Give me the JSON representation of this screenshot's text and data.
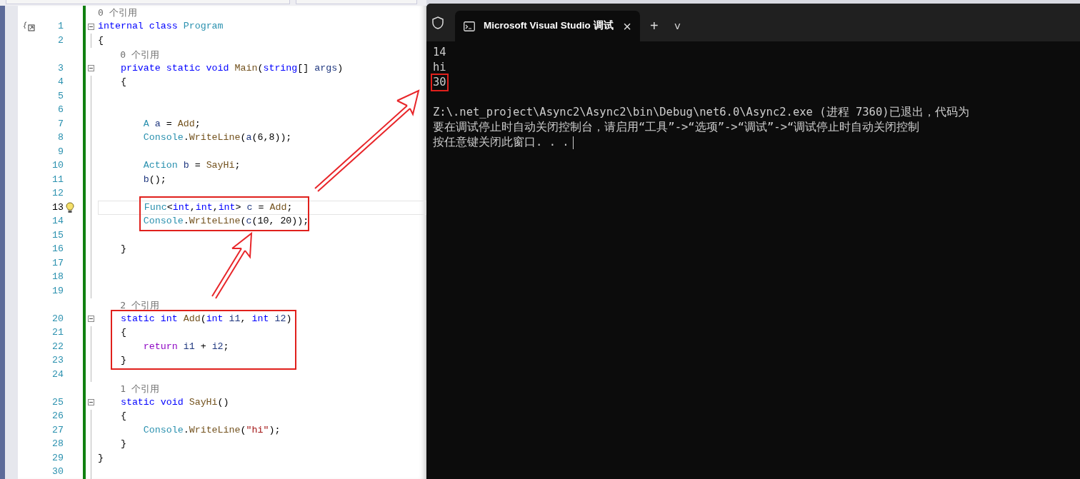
{
  "editor": {
    "rows": [
      {
        "kind": "lens",
        "text": "0 个引用"
      },
      {
        "kind": "code",
        "number": "1",
        "fold": true,
        "marker": true,
        "current": false,
        "tokens": [
          {
            "kind": "keyword",
            "text": "internal "
          },
          {
            "kind": "keyword",
            "text": "class "
          },
          {
            "kind": "type",
            "text": "Program"
          }
        ]
      },
      {
        "kind": "code",
        "number": "2",
        "fold": false,
        "marker": false,
        "current": false,
        "tokens": [
          {
            "kind": "plain",
            "text": "{"
          }
        ]
      },
      {
        "kind": "lens",
        "text": "    0 个引用"
      },
      {
        "kind": "code",
        "number": "3",
        "fold": true,
        "marker": false,
        "current": false,
        "tokens": [
          {
            "kind": "keyword",
            "text": "    private static void "
          },
          {
            "kind": "method",
            "text": "Main"
          },
          {
            "kind": "plain",
            "text": "("
          },
          {
            "kind": "keyword",
            "text": "string"
          },
          {
            "kind": "plain",
            "text": "[] "
          },
          {
            "kind": "variable",
            "text": "args"
          },
          {
            "kind": "plain",
            "text": ")"
          }
        ]
      },
      {
        "kind": "code",
        "number": "4",
        "fold": false,
        "marker": false,
        "current": false,
        "tokens": [
          {
            "kind": "plain",
            "text": "    {"
          }
        ]
      },
      {
        "kind": "code",
        "number": "5",
        "fold": false,
        "marker": false,
        "current": false,
        "tokens": []
      },
      {
        "kind": "code",
        "number": "6",
        "fold": false,
        "marker": false,
        "current": false,
        "tokens": []
      },
      {
        "kind": "code",
        "number": "7",
        "fold": false,
        "marker": false,
        "current": false,
        "tokens": [
          {
            "kind": "type",
            "text": "        A "
          },
          {
            "kind": "variable",
            "text": "a"
          },
          {
            "kind": "plain",
            "text": " = "
          },
          {
            "kind": "method",
            "text": "Add"
          },
          {
            "kind": "plain",
            "text": ";"
          }
        ]
      },
      {
        "kind": "code",
        "number": "8",
        "fold": false,
        "marker": false,
        "current": false,
        "tokens": [
          {
            "kind": "type",
            "text": "        Console"
          },
          {
            "kind": "plain",
            "text": "."
          },
          {
            "kind": "method",
            "text": "WriteLine"
          },
          {
            "kind": "plain",
            "text": "("
          },
          {
            "kind": "variable",
            "text": "a"
          },
          {
            "kind": "plain",
            "text": "(6,8));"
          }
        ]
      },
      {
        "kind": "code",
        "number": "9",
        "fold": false,
        "marker": false,
        "current": false,
        "tokens": []
      },
      {
        "kind": "code",
        "number": "10",
        "fold": false,
        "marker": false,
        "current": false,
        "tokens": [
          {
            "kind": "type",
            "text": "        Action "
          },
          {
            "kind": "variable",
            "text": "b"
          },
          {
            "kind": "plain",
            "text": " = "
          },
          {
            "kind": "method",
            "text": "SayHi"
          },
          {
            "kind": "plain",
            "text": ";"
          }
        ]
      },
      {
        "kind": "code",
        "number": "11",
        "fold": false,
        "marker": false,
        "current": false,
        "tokens": [
          {
            "kind": "variable",
            "text": "        b"
          },
          {
            "kind": "plain",
            "text": "();"
          }
        ]
      },
      {
        "kind": "code",
        "number": "12",
        "fold": false,
        "marker": false,
        "current": false,
        "tokens": []
      },
      {
        "kind": "code",
        "number": "13",
        "fold": false,
        "marker": false,
        "current": true,
        "tokens": [
          {
            "kind": "type",
            "text": "        Func"
          },
          {
            "kind": "plain",
            "text": "<"
          },
          {
            "kind": "keyword",
            "text": "int"
          },
          {
            "kind": "plain",
            "text": ","
          },
          {
            "kind": "keyword",
            "text": "int"
          },
          {
            "kind": "plain",
            "text": ","
          },
          {
            "kind": "keyword",
            "text": "int"
          },
          {
            "kind": "plain",
            "text": "> "
          },
          {
            "kind": "variable",
            "text": "c"
          },
          {
            "kind": "plain",
            "text": " = "
          },
          {
            "kind": "method",
            "text": "Add"
          },
          {
            "kind": "plain",
            "text": ";"
          }
        ]
      },
      {
        "kind": "code",
        "number": "14",
        "fold": false,
        "marker": false,
        "current": false,
        "tokens": [
          {
            "kind": "type",
            "text": "        Console"
          },
          {
            "kind": "plain",
            "text": "."
          },
          {
            "kind": "method",
            "text": "WriteLine"
          },
          {
            "kind": "plain",
            "text": "("
          },
          {
            "kind": "variable",
            "text": "c"
          },
          {
            "kind": "plain",
            "text": "(10, 20));"
          }
        ]
      },
      {
        "kind": "code",
        "number": "15",
        "fold": false,
        "marker": false,
        "current": false,
        "tokens": []
      },
      {
        "kind": "code",
        "number": "16",
        "fold": false,
        "marker": false,
        "current": false,
        "tokens": [
          {
            "kind": "plain",
            "text": "    }"
          }
        ]
      },
      {
        "kind": "code",
        "number": "17",
        "fold": false,
        "marker": false,
        "current": false,
        "tokens": []
      },
      {
        "kind": "code",
        "number": "18",
        "fold": false,
        "marker": false,
        "current": false,
        "tokens": []
      },
      {
        "kind": "code",
        "number": "19",
        "fold": false,
        "marker": false,
        "current": false,
        "tokens": []
      },
      {
        "kind": "lens",
        "text": "    2 个引用"
      },
      {
        "kind": "code",
        "number": "20",
        "fold": true,
        "marker": false,
        "current": false,
        "tokens": [
          {
            "kind": "keyword",
            "text": "    static int "
          },
          {
            "kind": "method",
            "text": "Add"
          },
          {
            "kind": "plain",
            "text": "("
          },
          {
            "kind": "keyword",
            "text": "int "
          },
          {
            "kind": "variable",
            "text": "i1"
          },
          {
            "kind": "plain",
            "text": ", "
          },
          {
            "kind": "keyword",
            "text": "int "
          },
          {
            "kind": "variable",
            "text": "i2"
          },
          {
            "kind": "plain",
            "text": ")"
          }
        ]
      },
      {
        "kind": "code",
        "number": "21",
        "fold": false,
        "marker": false,
        "current": false,
        "tokens": [
          {
            "kind": "plain",
            "text": "    {"
          }
        ]
      },
      {
        "kind": "code",
        "number": "22",
        "fold": false,
        "marker": false,
        "current": false,
        "tokens": [
          {
            "kind": "control",
            "text": "        return "
          },
          {
            "kind": "variable",
            "text": "i1"
          },
          {
            "kind": "plain",
            "text": " + "
          },
          {
            "kind": "variable",
            "text": "i2"
          },
          {
            "kind": "plain",
            "text": ";"
          }
        ]
      },
      {
        "kind": "code",
        "number": "23",
        "fold": false,
        "marker": false,
        "current": false,
        "tokens": [
          {
            "kind": "plain",
            "text": "    }"
          }
        ]
      },
      {
        "kind": "code",
        "number": "24",
        "fold": false,
        "marker": false,
        "current": false,
        "tokens": []
      },
      {
        "kind": "lens",
        "text": "    1 个引用"
      },
      {
        "kind": "code",
        "number": "25",
        "fold": true,
        "marker": false,
        "current": false,
        "tokens": [
          {
            "kind": "keyword",
            "text": "    static void "
          },
          {
            "kind": "method",
            "text": "SayHi"
          },
          {
            "kind": "plain",
            "text": "()"
          }
        ]
      },
      {
        "kind": "code",
        "number": "26",
        "fold": false,
        "marker": false,
        "current": false,
        "tokens": [
          {
            "kind": "plain",
            "text": "    {"
          }
        ]
      },
      {
        "kind": "code",
        "number": "27",
        "fold": false,
        "marker": false,
        "current": false,
        "tokens": [
          {
            "kind": "type",
            "text": "        Console"
          },
          {
            "kind": "plain",
            "text": "."
          },
          {
            "kind": "method",
            "text": "WriteLine"
          },
          {
            "kind": "plain",
            "text": "("
          },
          {
            "kind": "string",
            "text": "\"hi\""
          },
          {
            "kind": "plain",
            "text": ");"
          }
        ]
      },
      {
        "kind": "code",
        "number": "28",
        "fold": false,
        "marker": false,
        "current": false,
        "tokens": [
          {
            "kind": "plain",
            "text": "    }"
          }
        ]
      },
      {
        "kind": "code",
        "number": "29",
        "fold": false,
        "marker": false,
        "current": false,
        "tokens": [
          {
            "kind": "plain",
            "text": "}"
          }
        ]
      },
      {
        "kind": "code",
        "number": "30",
        "fold": false,
        "marker": false,
        "current": false,
        "tokens": []
      }
    ]
  },
  "terminal": {
    "tab": {
      "title": "Microsoft Visual Studio 调试",
      "close": "×"
    },
    "new_tab": "+",
    "dropdown": "˅",
    "lines": [
      {
        "text": "14",
        "boxed": false
      },
      {
        "text": "hi",
        "boxed": false
      },
      {
        "text": "30",
        "boxed": true
      },
      {
        "boxed": false
      },
      {
        "text": "Z:\\.net_project\\Async2\\Async2\\bin\\Debug\\net6.0\\Async2.exe (进程 7360)已退出，代码为",
        "boxed": false
      },
      {
        "text": "要在调试停止时自动关闭控制台，请启用“工具”->“选项”->“调试”->“调试停止时自动关闭控制",
        "boxed": false
      },
      {
        "text": "按任意键关闭此窗口. . .",
        "boxed": false,
        "cursor": true
      }
    ]
  }
}
